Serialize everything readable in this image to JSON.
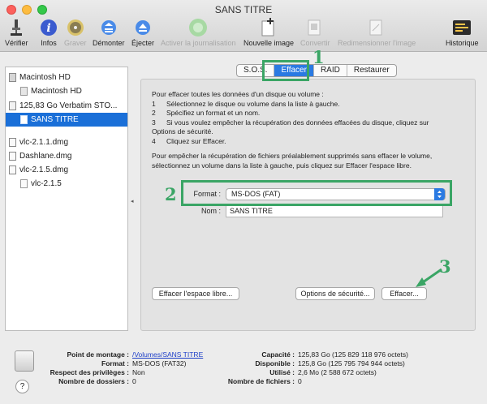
{
  "window": {
    "title": "SANS TITRE"
  },
  "toolbar": {
    "items": [
      {
        "label": "Vérifier",
        "icon": "microscope-icon"
      },
      {
        "label": "Infos",
        "icon": "info-icon"
      },
      {
        "label": "Graver",
        "icon": "burn-disc-icon"
      },
      {
        "label": "Démonter",
        "icon": "unmount-icon"
      },
      {
        "label": "Éjecter",
        "icon": "eject-icon"
      },
      {
        "label": "Activer la journalisation",
        "icon": "journaling-icon"
      },
      {
        "label": "Nouvelle image",
        "icon": "new-image-icon"
      },
      {
        "label": "Convertir",
        "icon": "convert-icon"
      },
      {
        "label": "Redimensionner l'image",
        "icon": "resize-image-icon"
      },
      {
        "label": "Historique",
        "icon": "log-icon"
      }
    ]
  },
  "sidebar": {
    "items": [
      {
        "label": "Macintosh HD",
        "icon": "internal-disk-icon"
      },
      {
        "label": "Macintosh HD",
        "icon": "volume-icon"
      },
      {
        "label": "125,83 Go Verbatim STO...",
        "icon": "external-disk-icon"
      },
      {
        "label": "SANS TITRE",
        "icon": "volume-icon"
      },
      {
        "label": "vlc-2.1.1.dmg",
        "icon": "dmg-file-icon"
      },
      {
        "label": "Dashlane.dmg",
        "icon": "dmg-file-icon"
      },
      {
        "label": "vlc-2.1.5.dmg",
        "icon": "dmg-file-icon"
      },
      {
        "label": "vlc-2.1.5",
        "icon": "volume-icon"
      }
    ]
  },
  "tabs": [
    {
      "label": "S.O.S."
    },
    {
      "label": "Effacer"
    },
    {
      "label": "RAID"
    },
    {
      "label": "Restaurer"
    }
  ],
  "instructions": {
    "intro": "Pour effacer toutes les données d'un disque ou volume :",
    "steps": [
      {
        "num": "1",
        "text": "Sélectionnez le disque ou volume dans la liste à gauche."
      },
      {
        "num": "2",
        "text": "Spécifiez un format et un nom."
      },
      {
        "num": "3",
        "text": "Si vous voulez empêcher la récupération des données effacées du disque, cliquez sur"
      },
      {
        "num": "",
        "text": "Options de sécurité."
      },
      {
        "num": "4",
        "text": "Cliquez sur Effacer."
      }
    ],
    "free_space_1": "Pour empêcher la récupération de fichiers préalablement supprimés sans effacer le volume,",
    "free_space_2": "sélectionnez un volume dans la liste à gauche, puis cliquez sur Effacer l'espace libre."
  },
  "form": {
    "format_label": "Format :",
    "format_value": "MS-DOS (FAT)",
    "name_label": "Nom :",
    "name_value": "SANS TITRE"
  },
  "buttons": {
    "erase_free_space": "Effacer l'espace libre...",
    "security_options": "Options de sécurité...",
    "erase": "Effacer..."
  },
  "annotations": {
    "one": "1",
    "two": "2",
    "three": "3"
  },
  "footer": {
    "mount_point_label": "Point de montage :",
    "mount_point_value": "/Volumes/SANS TITRE",
    "format_label": "Format :",
    "format_value": "MS-DOS (FAT32)",
    "owners_label": "Respect des privilèges :",
    "owners_value": "Non",
    "folders_label": "Nombre de dossiers :",
    "folders_value": "0",
    "capacity_label": "Capacité :",
    "capacity_value": "125,83 Go (125 829 118 976 octets)",
    "available_label": "Disponible :",
    "available_value": "125,8 Go (125 795 794 944 octets)",
    "used_label": "Utilisé :",
    "used_value": "2,6 Mo (2 588 672 octets)",
    "files_label": "Nombre de fichiers :",
    "files_value": "0",
    "help": "?"
  },
  "colors": {
    "accent": "#2a7ae2",
    "selection": "#1a6fd8",
    "annotation": "#3aa565"
  }
}
